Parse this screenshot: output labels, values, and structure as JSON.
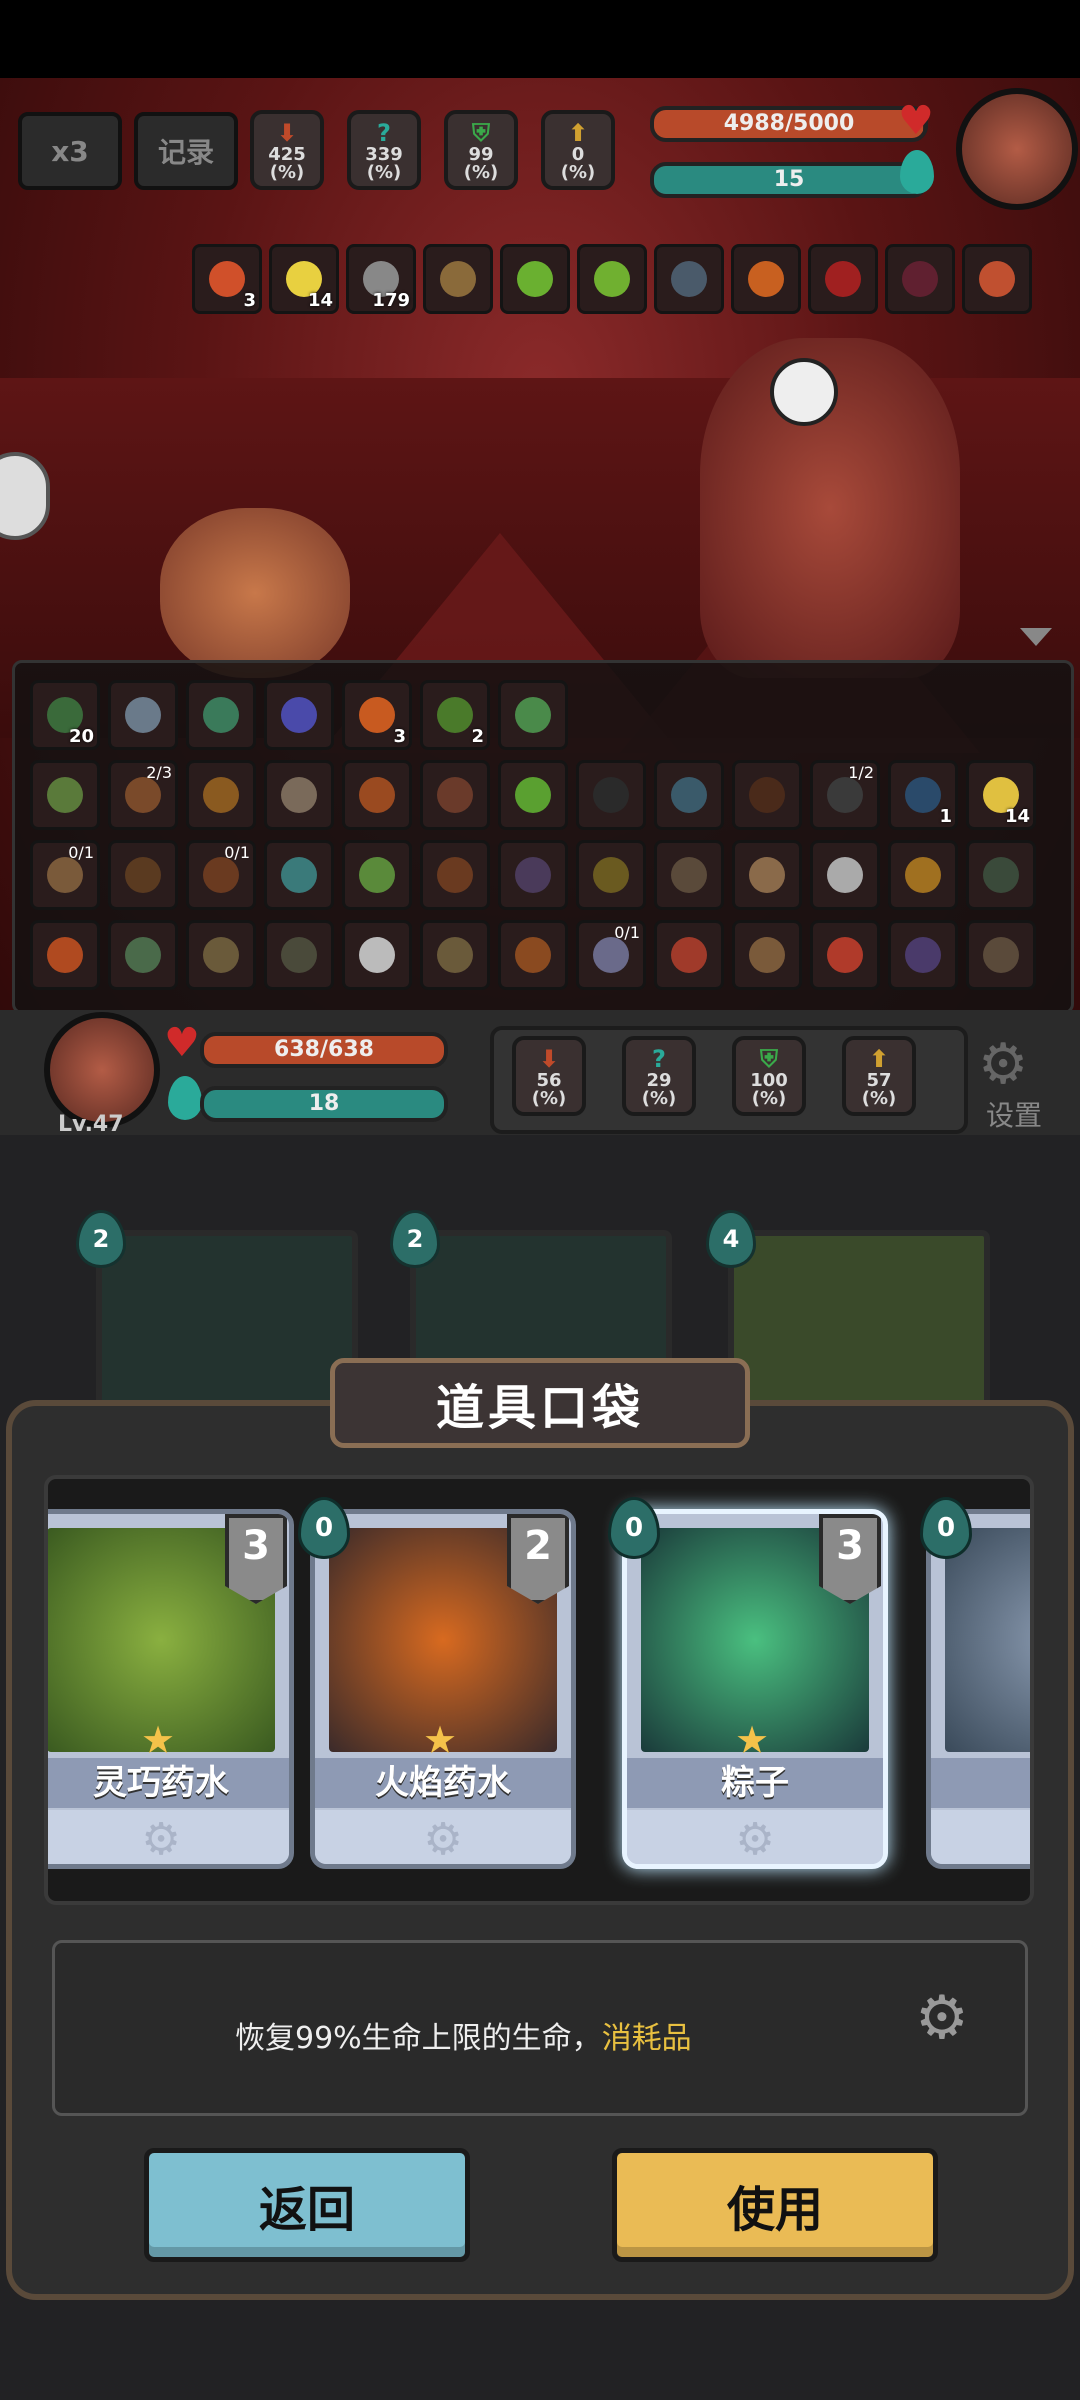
{
  "top_buttons": {
    "speed": "x3",
    "record": "记录"
  },
  "enemy_stats": [
    "425\n(%)",
    "339\n(%)",
    "99\n(%)",
    "0\n(%)"
  ],
  "enemy_stat_values": [
    "425",
    "339",
    "99",
    "0"
  ],
  "stat_unit": "(%)",
  "enemy_hp": "4988/5000",
  "enemy_hp_ratio": 0.9976,
  "enemy_mana": "15",
  "enemy_buffs": [
    {
      "count": "3",
      "color": "#d0502a"
    },
    {
      "count": "14",
      "color": "#e8d040"
    },
    {
      "count": "179",
      "color": "#888888"
    },
    {
      "count": "",
      "color": "#8a6a3a"
    },
    {
      "count": "",
      "color": "#6ab030"
    },
    {
      "count": "",
      "color": "#70b030"
    },
    {
      "count": "",
      "color": "#4a5a6a"
    },
    {
      "count": "",
      "color": "#c86020"
    },
    {
      "count": "",
      "color": "#a02020"
    },
    {
      "count": "",
      "color": "#602030"
    },
    {
      "count": "",
      "color": "#c05030"
    }
  ],
  "inventory_rows": [
    [
      {
        "top": "",
        "count": "20",
        "color": "#3a6a3a"
      },
      {
        "top": "",
        "count": "",
        "color": "#6a7a8a"
      },
      {
        "top": "",
        "count": "",
        "color": "#3a7a5a"
      },
      {
        "top": "",
        "count": "",
        "color": "#4a4aaa"
      },
      {
        "top": "",
        "count": "3",
        "color": "#c85a20"
      },
      {
        "top": "",
        "count": "2",
        "color": "#4a7a2a"
      },
      {
        "top": "",
        "count": "",
        "color": "#4a8a4a"
      }
    ],
    [
      {
        "top": "",
        "count": "",
        "color": "#5a7a3a"
      },
      {
        "top": "2/3",
        "count": "",
        "color": "#7a4a2a"
      },
      {
        "top": "",
        "count": "",
        "color": "#8a5a20"
      },
      {
        "top": "",
        "count": "",
        "color": "#7a6a5a"
      },
      {
        "top": "",
        "count": "",
        "color": "#9a4a20"
      },
      {
        "top": "",
        "count": "",
        "color": "#6a3a2a"
      },
      {
        "top": "",
        "count": "",
        "color": "#5aa030"
      },
      {
        "top": "",
        "count": "",
        "color": "#2a2a2a"
      },
      {
        "top": "",
        "count": "",
        "color": "#3a5a6a"
      },
      {
        "top": "",
        "count": "",
        "color": "#4a2a1a"
      },
      {
        "top": "1/2",
        "count": "",
        "color": "#3a3a3a"
      },
      {
        "top": "",
        "count": "1",
        "color": "#2a4a6a"
      },
      {
        "top": "",
        "count": "14",
        "color": "#e0c040"
      }
    ],
    [
      {
        "top": "0/1",
        "count": "",
        "color": "#7a5a3a"
      },
      {
        "top": "",
        "count": "",
        "color": "#5a3a20"
      },
      {
        "top": "0/1",
        "count": "",
        "color": "#6a3a20"
      },
      {
        "top": "",
        "count": "",
        "color": "#3a7a7a"
      },
      {
        "top": "",
        "count": "",
        "color": "#5a8a3a"
      },
      {
        "top": "",
        "count": "",
        "color": "#6a3a20"
      },
      {
        "top": "",
        "count": "",
        "color": "#4a3a5a"
      },
      {
        "top": "",
        "count": "",
        "color": "#6a5a20"
      },
      {
        "top": "",
        "count": "",
        "color": "#5a4a3a"
      },
      {
        "top": "",
        "count": "",
        "color": "#8a6a4a"
      },
      {
        "top": "",
        "count": "",
        "color": "#aaaaaa"
      },
      {
        "top": "",
        "count": "",
        "color": "#a07020"
      },
      {
        "top": "",
        "count": "",
        "color": "#3a4a3a"
      }
    ],
    [
      {
        "top": "",
        "count": "",
        "color": "#b04a20"
      },
      {
        "top": "",
        "count": "",
        "color": "#4a6a4a"
      },
      {
        "top": "",
        "count": "",
        "color": "#6a5a3a"
      },
      {
        "top": "",
        "count": "",
        "color": "#4a4a3a"
      },
      {
        "top": "",
        "count": "",
        "color": "#bbbbbb"
      },
      {
        "top": "",
        "count": "",
        "color": "#6a5a3a"
      },
      {
        "top": "",
        "count": "",
        "color": "#8a4a20"
      },
      {
        "top": "0/1",
        "count": "",
        "color": "#6a6a8a"
      },
      {
        "top": "",
        "count": "",
        "color": "#a03a2a"
      },
      {
        "top": "",
        "count": "",
        "color": "#7a5a3a"
      },
      {
        "top": "",
        "count": "",
        "color": "#b03a2a"
      },
      {
        "top": "",
        "count": "",
        "color": "#4a3a6a"
      },
      {
        "top": "",
        "count": "",
        "color": "#5a4a3a"
      }
    ]
  ],
  "player": {
    "hp": "638/638",
    "hp_ratio": 1.0,
    "mana": "18",
    "level": "Lv.47",
    "stats": [
      "56",
      "29",
      "100",
      "57"
    ],
    "settings_label": "设置"
  },
  "background_cards": [
    {
      "cost": "2"
    },
    {
      "cost": "2"
    },
    {
      "cost": "4"
    }
  ],
  "pocket": {
    "title": "道具口袋",
    "cards": [
      {
        "name": "灵巧药水",
        "cost": "",
        "stack": "3",
        "art": "#5a8a2a"
      },
      {
        "name": "火焰药水",
        "cost": "0",
        "stack": "2",
        "art": "#8a3a20"
      },
      {
        "name": "粽子",
        "cost": "0",
        "stack": "3",
        "art": "#2a8a5a",
        "selected": true
      },
      {
        "name": "",
        "cost": "0",
        "stack": "",
        "art": "#5a6a8a"
      }
    ],
    "description": "恢复99%生命上限的生命，",
    "description_tag": "消耗品",
    "back_button": "返回",
    "use_button": "使用"
  },
  "colors": {
    "hp_bar": "#b84a2a",
    "mana_bar": "#2a8a80",
    "tag_yellow": "#e8c040",
    "back_button": "#7ebfd0",
    "use_button": "#eabb55"
  }
}
